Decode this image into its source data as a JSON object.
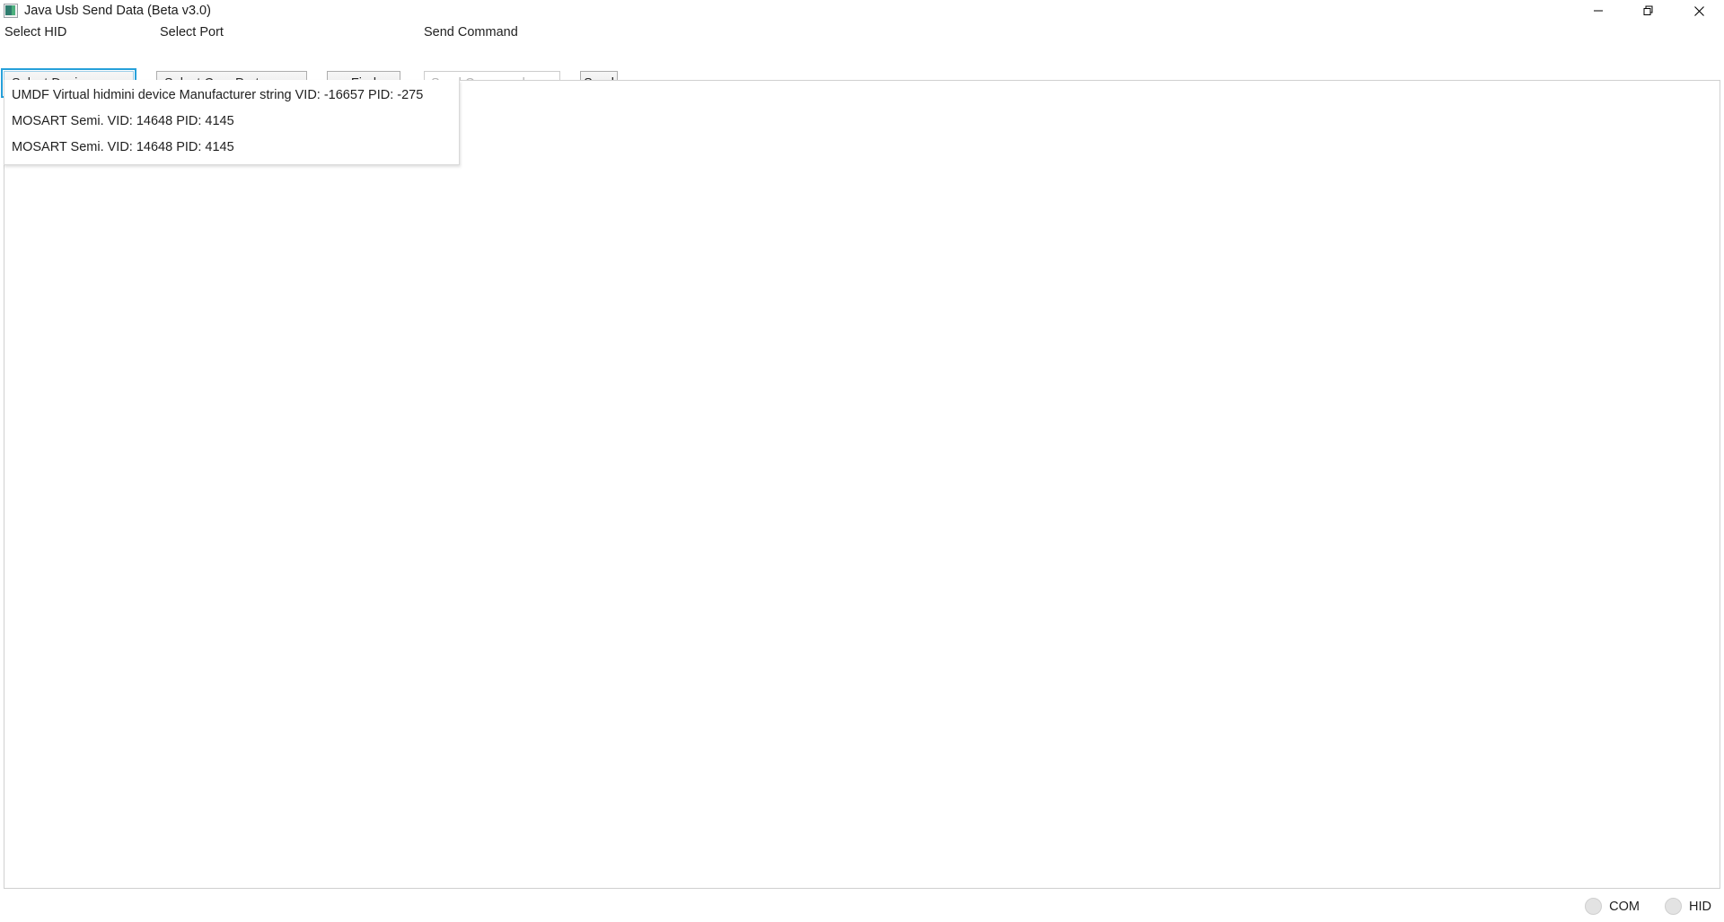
{
  "window": {
    "title": "Java Usb Send Data (Beta v3.0)",
    "icon": "app-icon",
    "controls": [
      {
        "name": "minimize",
        "glyph": "minimize-icon"
      },
      {
        "name": "restore",
        "glyph": "restore-icon"
      },
      {
        "name": "close",
        "glyph": "close-icon"
      }
    ]
  },
  "toolbar": {
    "hid_label": "Select HID",
    "hid_combo_value": "Select Device",
    "port_label": "Select Port",
    "port_combo_value": "Select Com Port",
    "find_button": "Find",
    "send_command_label": "Send Command",
    "send_command_value": "",
    "send_command_placeholder": "Send Command",
    "send_button": "Send"
  },
  "dropdown": {
    "open": true,
    "items": [
      "UMDF Virtual hidmini device Manufacturer string VID: -16657 PID: -275",
      "MOSART Semi. VID: 14648 PID: 4145",
      "MOSART Semi. VID: 14648 PID: 4145"
    ]
  },
  "output": {
    "text": ""
  },
  "status": {
    "indicators": [
      {
        "label": "COM",
        "state": "off",
        "color": "#e3e3e3"
      },
      {
        "label": "HID",
        "state": "off",
        "color": "#e3e3e3"
      }
    ]
  },
  "colors": {
    "focus_outline": "#26a0da",
    "window_bg": "#ffffff",
    "control_border": "#adadad",
    "led_off": "#e3e3e3"
  }
}
